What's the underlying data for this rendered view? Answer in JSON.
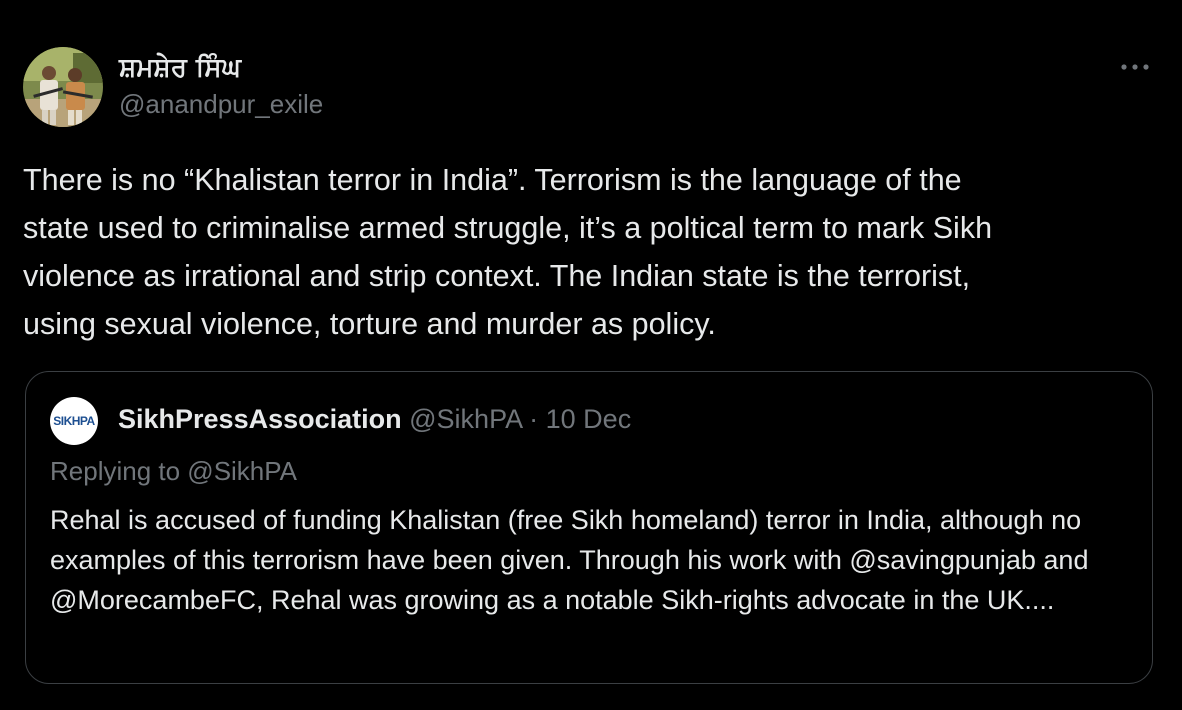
{
  "author": {
    "name": "ਸ਼ਮਸ਼ੇਰ ਸਿੰਘ",
    "handle": "@anandpur_exile",
    "avatar": "profile-photo"
  },
  "more_icon": "ellipsis-icon",
  "tweet": {
    "text": "There is no “Khalistan terror in India”. Terrorism is the language of the\nstate used to criminalise armed struggle, it’s a poltical term to mark Sikh\nviolence as irrational and strip context. The Indian state is the terrorist,\nusing sexual violence, torture and murder as policy."
  },
  "quoted_tweet": {
    "avatar_text": "SIKHPA",
    "name": "SikhPressAssociation",
    "handle": "@SikhPA",
    "separator": "·",
    "date": "10 Dec",
    "replying_to": "Replying to @SikhPA",
    "text": "Rehal is accused of funding Khalistan (free Sikh homeland) terror in India, although no examples of this terrorism have been given. Through his work with @savingpunjab and @MorecambeFC, Rehal was growing as a notable Sikh-rights advocate in the UK...."
  },
  "colors": {
    "background": "#000000",
    "text_primary": "#e7e9ea",
    "text_secondary": "#71767b",
    "border": "#3b3f43"
  }
}
